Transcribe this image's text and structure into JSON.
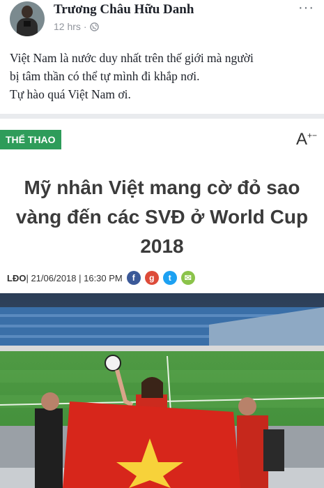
{
  "post": {
    "author": "Trương Châu Hữu Danh",
    "time": "12 hrs",
    "separator": "·",
    "audience_icon": "globe-icon",
    "more_icon": "···",
    "lines": [
      "Việt Nam là nước duy nhất trên thế giới mà người",
      "bị tâm thần có thể tự mình đi khắp nơi.",
      "Tự hào quá Việt Nam ơi."
    ]
  },
  "article": {
    "category": "THỂ THAO",
    "font_size_control": "A",
    "font_size_sup": "+−",
    "headline_lines": [
      "Mỹ nhân Việt mang cờ đỏ sao",
      "vàng đến các SVĐ ở World Cup",
      "2018"
    ],
    "source": "LĐO",
    "byline_rest": " | 21/06/2018 | 16:30 PM",
    "share": [
      {
        "name": "facebook-icon",
        "glyph": "f",
        "color": "#3b5998"
      },
      {
        "name": "google-plus-icon",
        "glyph": "g",
        "color": "#dd4b39"
      },
      {
        "name": "twitter-icon",
        "glyph": "t",
        "color": "#1da1f2"
      },
      {
        "name": "email-icon",
        "glyph": "✉",
        "color": "#8bc34a"
      }
    ]
  }
}
